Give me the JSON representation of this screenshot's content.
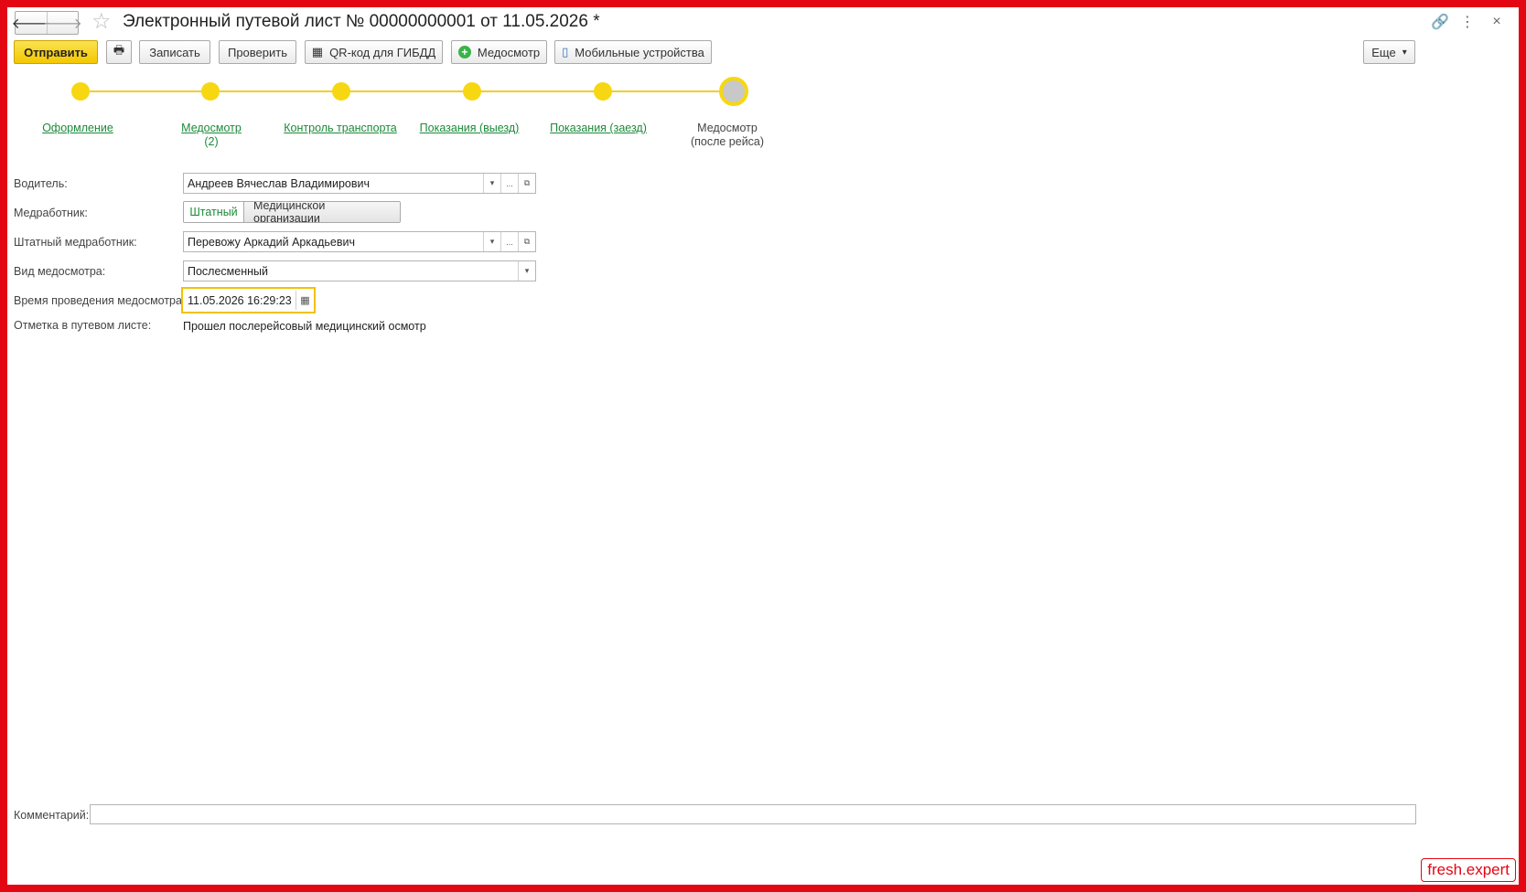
{
  "window": {
    "title": "Электронный путевой лист № 00000000001 от 11.05.2026 *"
  },
  "nav": {
    "back_icon": "🡐",
    "forward_icon": "🡒"
  },
  "title_icons": {
    "link": "🔗",
    "menu": "⋮",
    "close": "×"
  },
  "toolbar": {
    "send_label": "Отправить",
    "print_icon": "🖶",
    "save_label": "Записать",
    "check_label": "Проверить",
    "qr_label": "QR-код для ГИБДД",
    "qr_icon": "▦",
    "medical_label": "Медосмотр",
    "plus_icon": "+",
    "mobile_label": "Мобильные устройства",
    "mobile_icon": "▯",
    "more_label": "Еще",
    "more_caret": "▾"
  },
  "steps": [
    {
      "label": "Оформление",
      "sub": "",
      "link": true
    },
    {
      "label": "Медосмотр",
      "sub": "(2)",
      "link": true
    },
    {
      "label": "Контроль транспорта",
      "sub": "",
      "link": true
    },
    {
      "label": "Показания (выезд)",
      "sub": "",
      "link": true
    },
    {
      "label": "Показания (заезд)",
      "sub": "",
      "link": true
    },
    {
      "label": "Медосмотр",
      "sub": "(после рейса)",
      "link": false
    }
  ],
  "form": {
    "driver_label": "Водитель:",
    "driver_value": "Андреев Вячеслав Владимирович",
    "medworker_label": "Медработник:",
    "medworker_option_staff": "Штатный",
    "medworker_option_org": "Медицинской организации",
    "staff_medworker_label": "Штатный медработник:",
    "staff_medworker_value": "Перевожу Аркадий Аркадьевич",
    "exam_type_label": "Вид медосмотра:",
    "exam_type_value": "Послесменный",
    "exam_time_label": "Время проведения медосмотра:",
    "exam_time_value": "11.05.2026 16:29:23",
    "mark_label": "Отметка в путевом листе:",
    "mark_value": "Прошел послерейсовый медицинский осмотр",
    "dropdown_caret": "▾",
    "ellipsis": "...",
    "open_icon": "⧉",
    "calendar_icon": "▦"
  },
  "comment": {
    "label": "Комментарий:",
    "value": ""
  },
  "watermark": "fresh.expert",
  "colors": {
    "accent": "#f7d711",
    "link": "#1b8a3a",
    "frame": "#e30613"
  }
}
